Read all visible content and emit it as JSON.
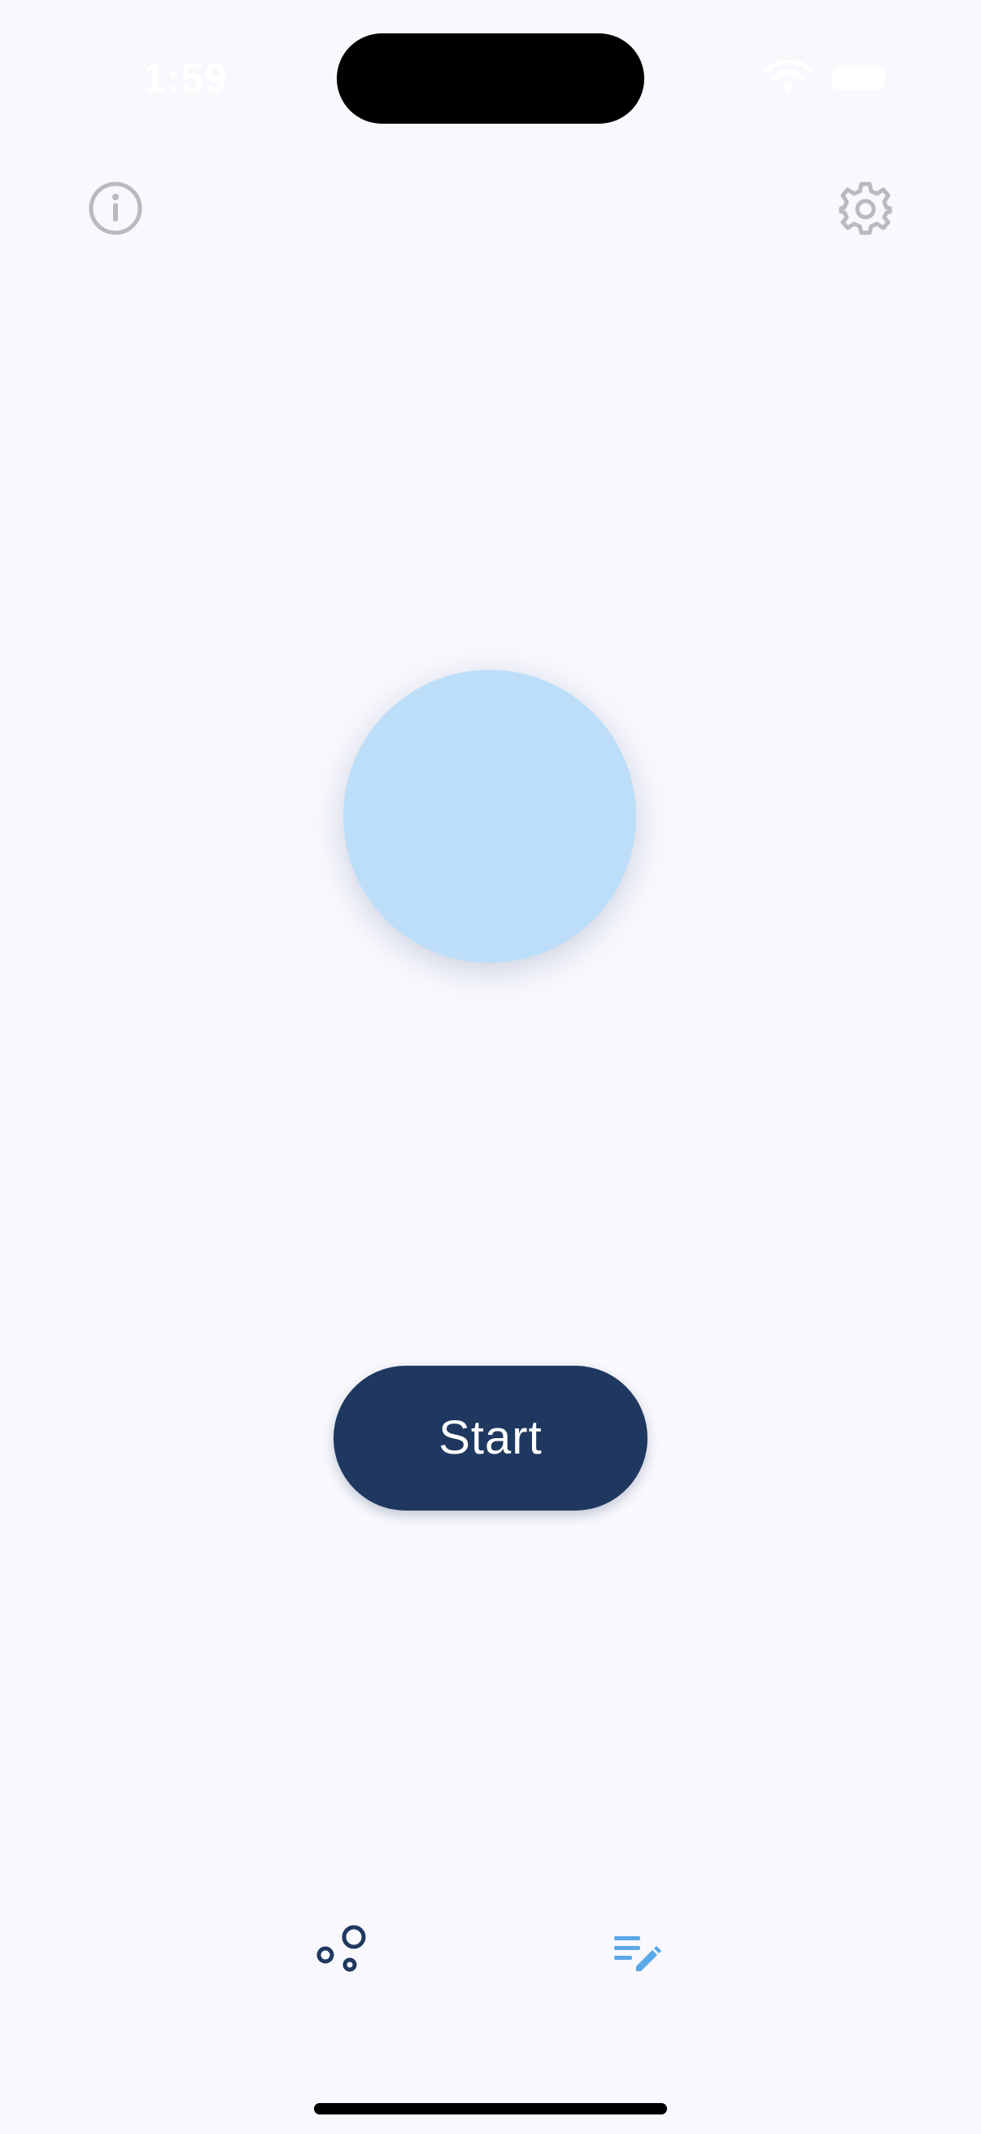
{
  "status_bar": {
    "time": "1:59"
  },
  "top_bar": {
    "info_icon": "info-icon",
    "settings_icon": "gear-icon"
  },
  "main": {
    "start_label": "Start",
    "circle_color": "#bcdef9",
    "button_color": "#1f3860"
  },
  "bottom_nav": {
    "items": [
      {
        "icon": "bubbles-icon",
        "active": false
      },
      {
        "icon": "notes-edit-icon",
        "active": true
      }
    ],
    "active_color": "#5aa8e8",
    "inactive_color": "#1f3860"
  }
}
